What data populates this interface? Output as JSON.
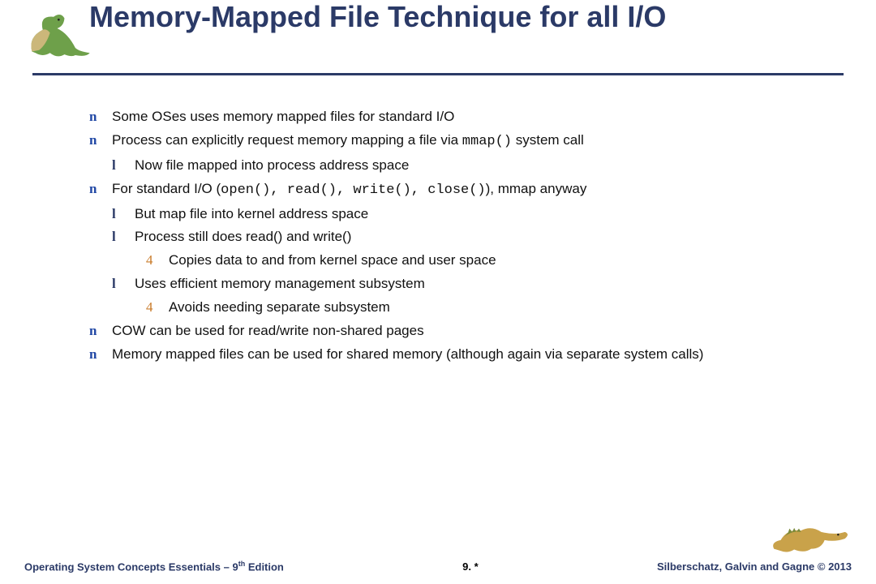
{
  "title": "Memory-Mapped File Technique for all I/O",
  "bullets": {
    "b1": "Some OSes  uses memory mapped files for standard I/O",
    "b2a": "Process can explicitly request memory mapping a file via ",
    "b2b": "mmap()",
    "b2c": " system call",
    "b2_1": "Now file mapped into process address space",
    "b3a": "For standard I/O (",
    "b3b": "open(), read(), write(), close()",
    "b3c": "), mmap anyway",
    "b3_1": "But map file into kernel address space",
    "b3_2": "Process still does read() and write()",
    "b3_2_1": "Copies data to and from kernel space and user space",
    "b3_3": "Uses efficient memory management subsystem",
    "b3_3_1": "Avoids needing separate subsystem",
    "b4": "COW can be used for read/write non-shared pages",
    "b5": "Memory mapped files can be  used for shared memory (although again via separate system calls)"
  },
  "marks": {
    "l1": "n",
    "l2": "l",
    "l3": "4"
  },
  "footer": {
    "left_a": "Operating System Concepts Essentials – 9",
    "left_sup": "th",
    "left_b": " Edition",
    "center": "9. *",
    "right": "Silberschatz, Galvin and Gagne © 2013"
  }
}
